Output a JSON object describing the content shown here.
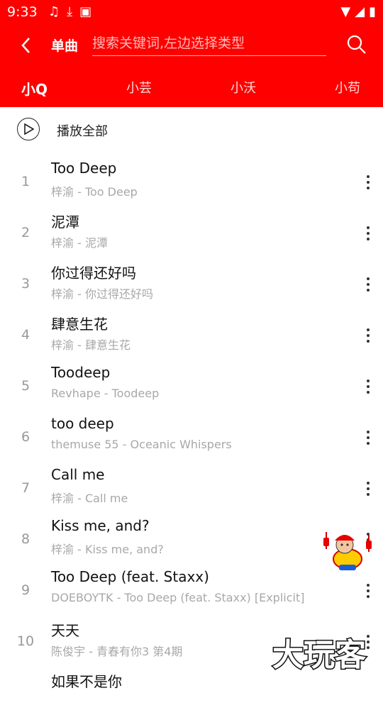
{
  "status_bar": {
    "time": "9:33",
    "icons": [
      "music-note-icon",
      "download-icon",
      "a-icon"
    ],
    "right_icons": [
      "wifi-icon",
      "signal-icon",
      "battery-icon"
    ]
  },
  "header": {
    "title": "单曲",
    "search_placeholder": "搜索关键词,左边选择类型",
    "search_value": ""
  },
  "tabs": [
    {
      "label": "小Q",
      "active": true
    },
    {
      "label": "小芸",
      "active": false
    },
    {
      "label": "小沃",
      "active": false
    },
    {
      "label": "小苟",
      "active": false
    }
  ],
  "play_all": {
    "label": "播放全部"
  },
  "songs": [
    {
      "index": "1",
      "title": "Too Deep",
      "meta": "梓渝 - Too Deep"
    },
    {
      "index": "2",
      "title": "泥潭",
      "meta": "梓渝 - 泥潭"
    },
    {
      "index": "3",
      "title": "你过得还好吗",
      "meta": "梓渝 - 你过得还好吗"
    },
    {
      "index": "4",
      "title": "肆意生花",
      "meta": "梓渝 - 肆意生花"
    },
    {
      "index": "5",
      "title": "Toodeep",
      "meta": "Revhape - Toodeep"
    },
    {
      "index": "6",
      "title": "too deep",
      "meta": "themuse 55 - Oceanic Whispers"
    },
    {
      "index": "7",
      "title": "Call me",
      "meta": "梓渝 - Call me"
    },
    {
      "index": "8",
      "title": "Kiss me, and?",
      "meta": "梓渝 - Kiss me, and?"
    },
    {
      "index": "9",
      "title": "Too Deep (feat. Staxx)",
      "meta": "DOEBOYTK - Too Deep (feat. Staxx) [Explicit]"
    },
    {
      "index": "10",
      "title": "天天",
      "meta": "陈俊宇 - 青春有你3 第4期"
    },
    {
      "index": "",
      "title": "如果不是你",
      "meta": ""
    }
  ],
  "watermark": {
    "text": "大玩客"
  },
  "colors": {
    "accent": "#ff0000",
    "title_text": "#111111",
    "meta_text": "#a8a8a8",
    "index_text": "#999999"
  }
}
